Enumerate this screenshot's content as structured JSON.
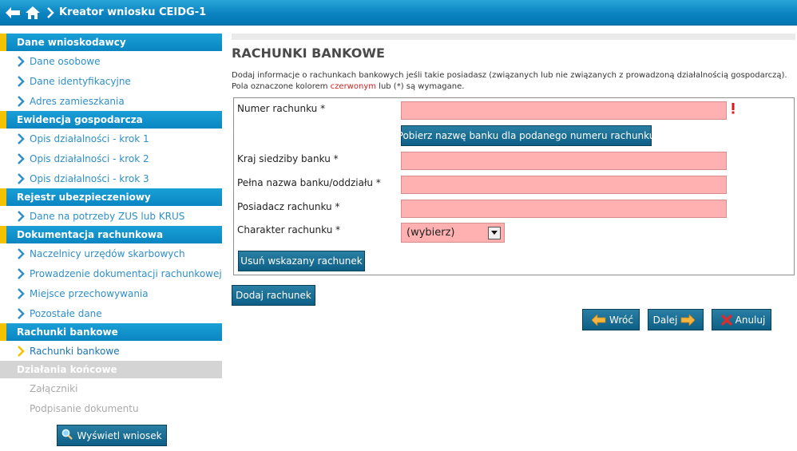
{
  "header": {
    "title": "Kreator wniosku CEIDG-1"
  },
  "sidebar": {
    "sections": [
      {
        "title": "Dane wnioskodawcy",
        "items": [
          "Dane osobowe",
          "Dane identyfikacyjne",
          "Adres zamieszkania"
        ]
      },
      {
        "title": "Ewidencja gospodarcza",
        "items": [
          "Opis działalności - krok 1",
          "Opis działalności - krok 2",
          "Opis działalności - krok 3"
        ]
      },
      {
        "title": "Rejestr ubezpieczeniowy",
        "items": [
          "Dane na potrzeby ZUS lub KRUS"
        ]
      },
      {
        "title": "Dokumentacja rachunkowa",
        "items": [
          "Naczelnicy urzędów skarbowych",
          "Prowadzenie dokumentacji rachunkowej",
          "Miejsce przechowywania",
          "Pozostałe dane"
        ]
      },
      {
        "title": "Rachunki bankowe",
        "items": [
          "Rachunki bankowe"
        ]
      },
      {
        "title": "Działania końcowe",
        "items": [
          "Załączniki",
          "Podpisanie dokumentu"
        ]
      }
    ],
    "show_button": "Wyświetl wniosek"
  },
  "main": {
    "title": "RACHUNKI BANKOWE",
    "info_line1": "Dodaj informacje o rachunkach bankowych jeśli takie posiadasz (związanych lub nie związanych z prowadzoną działalnością gospodarczą).",
    "info_line2_a": "Pola oznaczone kolorem ",
    "info_line2_red": "czerwonym",
    "info_line2_b": " lub (*) są wymagane.",
    "form": {
      "account_number_label": "Numer rachunku *",
      "account_number_value": "",
      "fetch_bank_button": "Pobierz nazwę banku dla podanego numeru rachunku",
      "bank_country_label": "Kraj siedziby banku *",
      "bank_country_value": "",
      "bank_name_label": "Pełna nazwa banku/oddziału *",
      "bank_name_value": "",
      "account_holder_label": "Posiadacz rachunku *",
      "account_holder_value": "",
      "account_type_label": "Charakter rachunku *",
      "account_type_selected": "(wybierz)",
      "delete_button": "Usuń wskazany rachunek"
    },
    "add_button": "Dodaj rachunek",
    "back_button": "Wróć",
    "next_button": "Dalej",
    "cancel_button": "Anuluj"
  },
  "colors": {
    "header_blue": "#0a83c0",
    "section_accent": "#f5c200",
    "required_field": "#ffb0b0",
    "button_dark": "#0d5f86",
    "link_blue": "#2f8fc8"
  },
  "icons": {
    "back": "back-arrow-icon",
    "home": "home-icon",
    "chevron": "chevron-right-icon",
    "required": "exclamation-icon",
    "search": "magnifier-icon",
    "prev": "arrow-left-icon",
    "next": "arrow-right-icon",
    "cancel": "x-icon"
  }
}
